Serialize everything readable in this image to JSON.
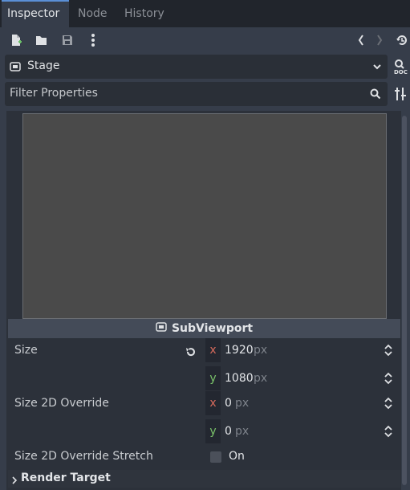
{
  "tabs": [
    {
      "label": "Inspector",
      "active": true
    },
    {
      "label": "Node",
      "active": false
    },
    {
      "label": "History",
      "active": false
    }
  ],
  "toolbar": {
    "icons": [
      "new-resource-icon",
      "open-folder-icon",
      "save-icon",
      "more-vertical-icon",
      "chevron-left-icon",
      "chevron-right-icon",
      "history-icon"
    ]
  },
  "object_selector": {
    "label": "Stage",
    "icon": "subviewport-icon"
  },
  "filter": {
    "placeholder": "Filter Properties"
  },
  "section": {
    "title": "SubViewport"
  },
  "properties": {
    "size": {
      "label": "Size",
      "x_axis": "x",
      "x_value": "1920",
      "x_unit": "px",
      "y_axis": "y",
      "y_value": "1080",
      "y_unit": "px"
    },
    "size_2d_override": {
      "label": "Size 2D Override",
      "x_axis": "x",
      "x_value": "0",
      "x_unit": "px",
      "y_axis": "y",
      "y_value": "0",
      "y_unit": "px"
    },
    "size_2d_override_stretch": {
      "label": "Size 2D Override Stretch",
      "checked": false,
      "value_label": "On"
    }
  },
  "render_target": {
    "title": "Render Target"
  },
  "colors": {
    "accent": "#5a8fd6",
    "x_axis": "#d66a5c",
    "y_axis": "#7ac26a",
    "panel_bg": "#363d4a"
  }
}
